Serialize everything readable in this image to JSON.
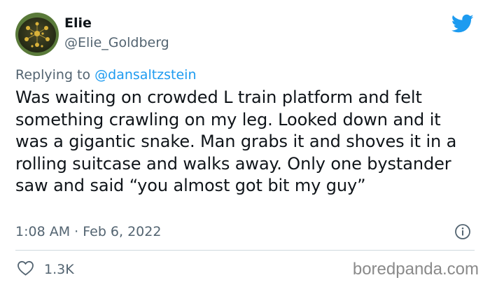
{
  "author": {
    "display_name": "Elie",
    "handle": "@Elie_Goldberg"
  },
  "reply": {
    "prefix": "Replying to ",
    "mention": "@dansaltzstein"
  },
  "tweet": {
    "text": "Was waiting on crowded L train platform and felt something crawling on my leg. Looked down and it was a gigantic snake. Man grabs it and shoves it in a rolling suitcase and walks away. Only one bystander saw and said “you almost got bit my guy”",
    "time": "1:08 AM",
    "separator": " · ",
    "date": "Feb 6, 2022"
  },
  "actions": {
    "like_count": "1.3K"
  },
  "watermark": "boredpanda.com",
  "icons": {
    "brand": "twitter-bird-icon",
    "info": "info-icon",
    "like": "heart-icon"
  },
  "colors": {
    "twitter_blue": "#1d9bf0",
    "text_primary": "#0f1419",
    "text_secondary": "#536471"
  }
}
